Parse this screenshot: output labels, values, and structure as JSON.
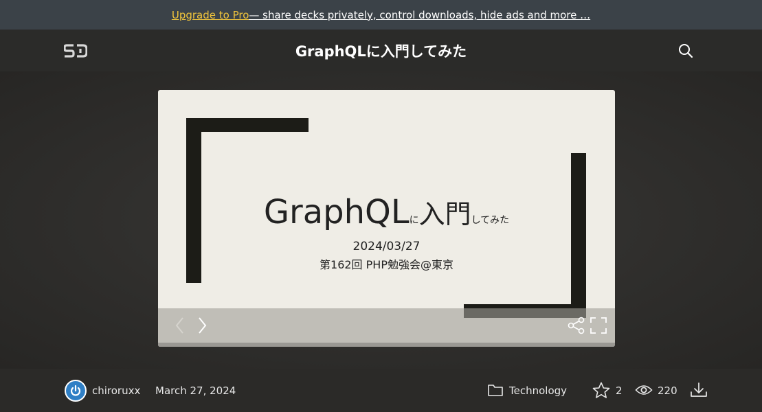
{
  "promo": {
    "link_text": "Upgrade to Pro",
    "rest_text": " — share decks privately, control downloads, hide ads and more …"
  },
  "header": {
    "logo_text": "SD",
    "title": "GraphQLに入門してみた"
  },
  "slide": {
    "title_main": "GraphQL",
    "title_particle": "に",
    "title_kanji": "入門",
    "title_suffix": "してみた",
    "date": "2024/03/27",
    "event": "第162回 PHP勉強会@東京"
  },
  "footer": {
    "author": "chiroruxx",
    "date": "March 27, 2024",
    "category": "Technology",
    "stars": "2",
    "views": "220"
  },
  "colors": {
    "promo_bg": "#3b4248",
    "pro_link": "#f0c43c",
    "page_bg": "#2d2c2a",
    "slide_bg": "#efede6",
    "bracket": "#1c1c17",
    "avatar": "#2f7fc5"
  },
  "icons": [
    "logo-icon",
    "search-icon",
    "prev-arrow-icon",
    "next-arrow-icon",
    "share-icon",
    "fullscreen-icon",
    "folder-icon",
    "star-icon",
    "eye-icon",
    "download-icon"
  ]
}
